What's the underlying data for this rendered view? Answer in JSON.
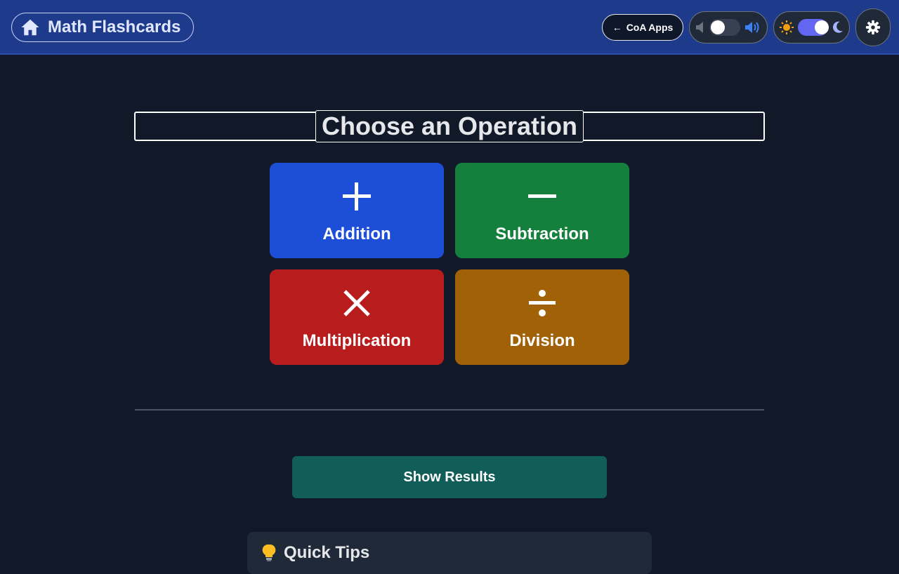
{
  "header": {
    "app_title": "Math Flashcards",
    "home_icon": "home-icon",
    "coa_apps": {
      "arrow": "←",
      "label": "CoA Apps"
    },
    "sound_toggle": {
      "state": "off",
      "mute_icon": "speaker-muted-icon",
      "on_icon": "speaker-loud-icon"
    },
    "theme_toggle": {
      "state": "dark",
      "light_icon": "sun-icon",
      "dark_icon": "moon-icon"
    },
    "settings_icon": "gear-icon"
  },
  "main": {
    "section_title": "Choose an Operation",
    "operations": [
      {
        "label": "Addition",
        "icon": "plus-icon",
        "color": "#1d4ed8"
      },
      {
        "label": "Subtraction",
        "icon": "minus-icon",
        "color": "#15803d"
      },
      {
        "label": "Multiplication",
        "icon": "times-icon",
        "color": "#b91c1c"
      },
      {
        "label": "Division",
        "icon": "divide-icon",
        "color": "#a16207"
      }
    ],
    "results_button": "Show Results",
    "tips": {
      "icon": "lightbulb-icon",
      "heading": "Quick Tips"
    }
  },
  "colors": {
    "header_bg": "#1e3a8a",
    "page_bg": "#111827",
    "results_bg": "#115e59",
    "toggle_accent": "#6366f1"
  }
}
